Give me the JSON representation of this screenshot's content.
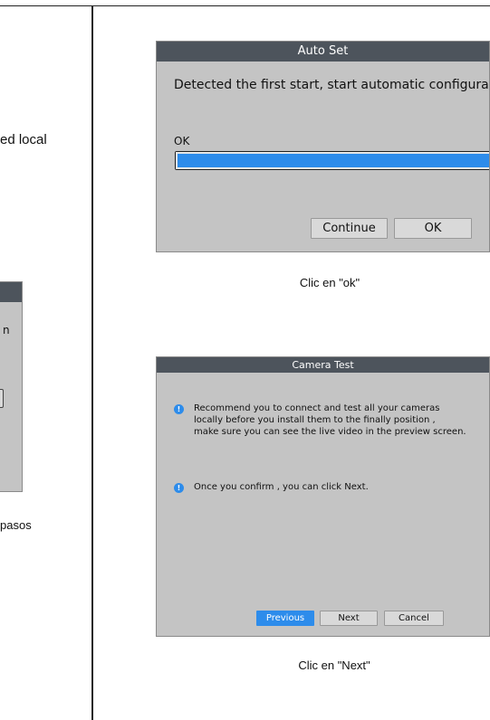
{
  "left_column": {
    "fragment_top": "ed local",
    "mini_window_text": "n",
    "fragment_bottom": "pasos"
  },
  "auto_set": {
    "title": "Auto Set",
    "message": "Detected the first start, start automatic configura",
    "status": "OK",
    "progress_percent": 100,
    "continue_label": "Continue",
    "ok_label": "OK"
  },
  "caption_1": "Clic en \"ok\"",
  "camera_test": {
    "title": "Camera Test",
    "item_1_lines": [
      "Recommend you to connect and test all your cameras",
      "locally before you install them to the finally position ,",
      "make sure you can see the live video in the preview screen."
    ],
    "item_2": "Once you confirm , you can click Next.",
    "previous_label": "Previous",
    "next_label": "Next",
    "cancel_label": "Cancel",
    "info_icon_glyph": "!"
  },
  "caption_2": "Clic en \"Next\"",
  "colors": {
    "titlebar": "#4d545c",
    "dialog_bg": "#c4c4c4",
    "accent_blue": "#2d8ceb"
  }
}
